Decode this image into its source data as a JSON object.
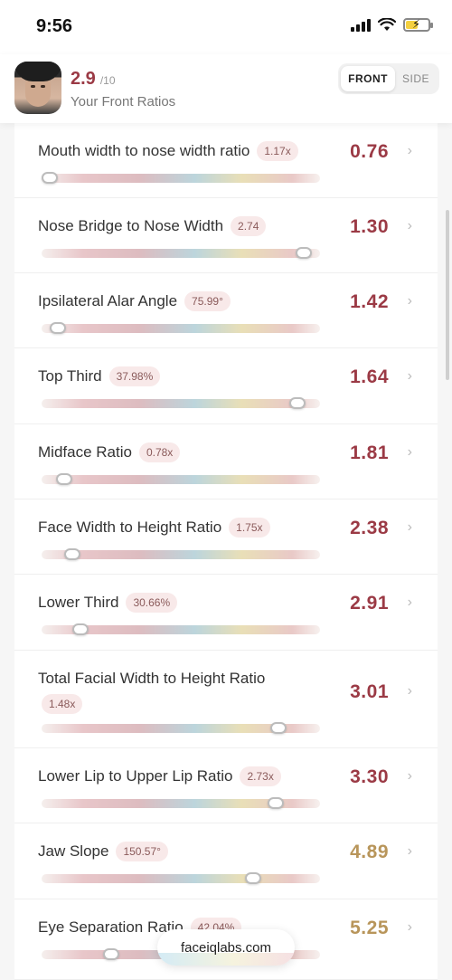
{
  "status": {
    "time": "9:56"
  },
  "header": {
    "score": "2.9",
    "score_max": "/10",
    "subtitle": "Your Front Ratios",
    "tabs": [
      "FRONT",
      "SIDE"
    ]
  },
  "colors": {
    "value_red": "#9b3a45",
    "value_gold": "#b8955a",
    "accent": "#9b3a45"
  },
  "ratios": [
    {
      "name": "Mouth width to nose width ratio",
      "pill": "1.17x",
      "value": "0.76",
      "level": 0.03,
      "color": "#9b3a45"
    },
    {
      "name": "Nose Bridge to Nose Width",
      "pill": "2.74",
      "value": "1.30",
      "level": 0.94,
      "color": "#9b3a45"
    },
    {
      "name": "Ipsilateral Alar Angle",
      "pill": "75.99°",
      "value": "1.42",
      "level": 0.06,
      "color": "#9b3a45"
    },
    {
      "name": "Top Third",
      "pill": "37.98%",
      "value": "1.64",
      "level": 0.92,
      "color": "#9b3a45"
    },
    {
      "name": "Midface Ratio",
      "pill": "0.78x",
      "value": "1.81",
      "level": 0.08,
      "color": "#9b3a45"
    },
    {
      "name": "Face Width to Height Ratio",
      "pill": "1.75x",
      "value": "2.38",
      "level": 0.11,
      "color": "#9b3a45"
    },
    {
      "name": "Lower Third",
      "pill": "30.66%",
      "value": "2.91",
      "level": 0.14,
      "color": "#9b3a45"
    },
    {
      "name": "Total Facial Width to Height Ratio",
      "pill": "1.48x",
      "value": "3.01",
      "level": 0.85,
      "color": "#9b3a45"
    },
    {
      "name": "Lower Lip to Upper Lip Ratio",
      "pill": "2.73x",
      "value": "3.30",
      "level": 0.84,
      "color": "#9b3a45"
    },
    {
      "name": "Jaw Slope",
      "pill": "150.57°",
      "value": "4.89",
      "level": 0.76,
      "color": "#b8955a"
    },
    {
      "name": "Eye Separation Ratio",
      "pill": "42.04%",
      "value": "5.25",
      "level": 0.25,
      "color": "#b8955a"
    }
  ],
  "footer": {
    "url": "faceiqlabs.com"
  }
}
